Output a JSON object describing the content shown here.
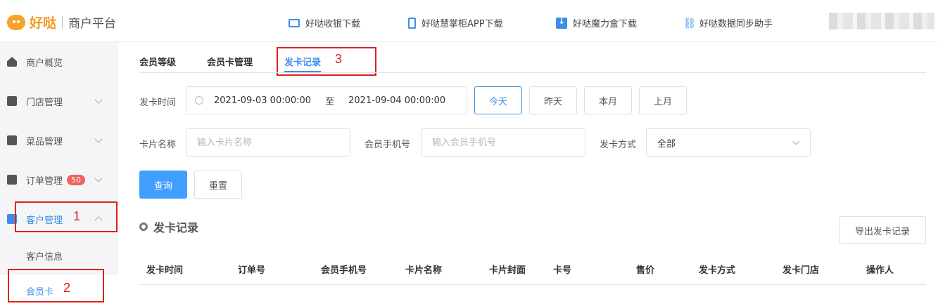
{
  "header": {
    "brand": "好哒",
    "subtitle": "商户平台",
    "links": [
      {
        "label": "好哒收银下载",
        "icon": "monitor-icon"
      },
      {
        "label": "好哒慧掌柜APP下载",
        "icon": "phone-icon"
      },
      {
        "label": "好哒魔力盒下载",
        "icon": "download-icon"
      },
      {
        "label": "好哒数据同步助手",
        "icon": "link-icon"
      }
    ]
  },
  "sidebar": {
    "items": [
      {
        "label": "商户概览",
        "icon": "home-icon"
      },
      {
        "label": "门店管理",
        "icon": "store-icon"
      },
      {
        "label": "菜品管理",
        "icon": "dish-icon"
      },
      {
        "label": "订单管理",
        "icon": "order-icon",
        "badge": "50"
      },
      {
        "label": "客户管理",
        "icon": "user-icon"
      }
    ],
    "sub_items": [
      {
        "label": "客户信息"
      },
      {
        "label": "会员卡"
      }
    ]
  },
  "annotations": [
    "1",
    "2",
    "3"
  ],
  "tabs": [
    {
      "label": "会员等级"
    },
    {
      "label": "会员卡管理"
    },
    {
      "label": "发卡记录"
    }
  ],
  "filters": {
    "issue_time_label": "发卡时间",
    "start": "2021-09-03 00:00:00",
    "range_sep": "至",
    "end": "2021-09-04 00:00:00",
    "quick": [
      "今天",
      "昨天",
      "本月",
      "上月"
    ],
    "card_name_label": "卡片名称",
    "card_name_placeholder": "输入卡片名称",
    "phone_label": "会员手机号",
    "phone_placeholder": "输入会员手机号",
    "method_label": "发卡方式",
    "method_value": "全部",
    "query": "查询",
    "reset": "重置"
  },
  "section": {
    "title": "发卡记录",
    "export": "导出发卡记录"
  },
  "table": {
    "columns": [
      "发卡时间",
      "订单号",
      "会员手机号",
      "卡片名称",
      "卡片封面",
      "卡号",
      "售价",
      "发卡方式",
      "发卡门店",
      "操作人"
    ]
  }
}
